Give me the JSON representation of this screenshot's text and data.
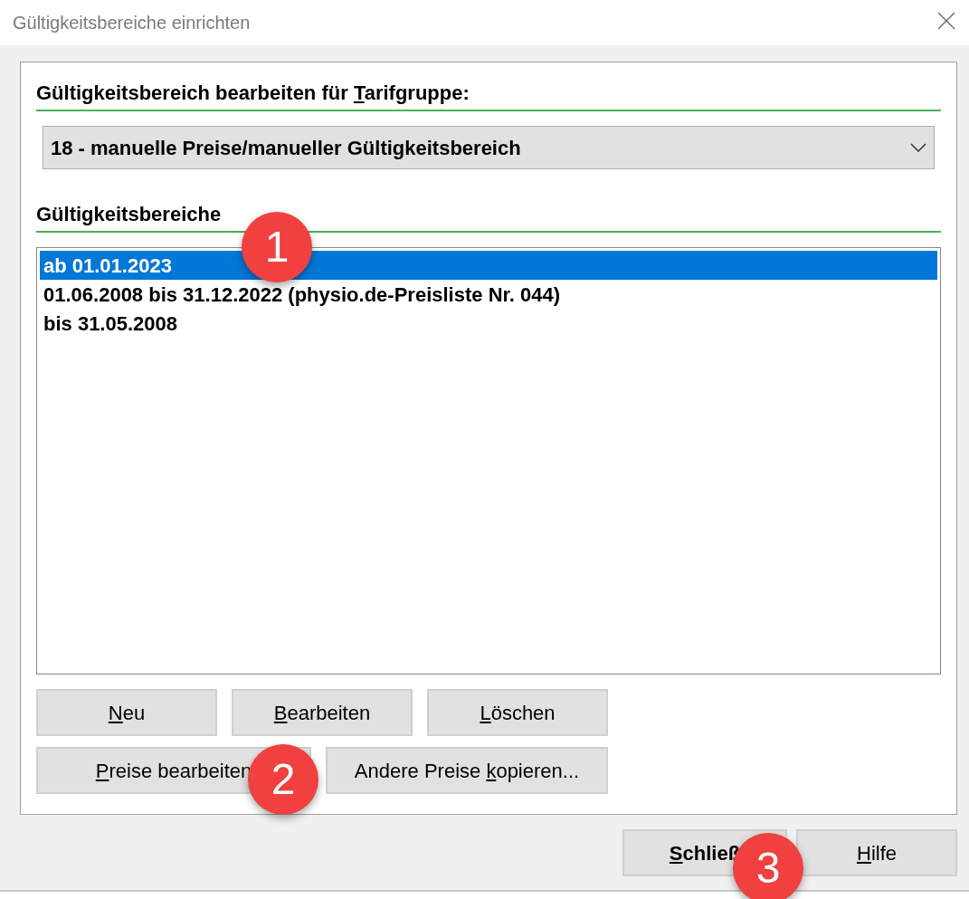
{
  "window": {
    "title": "Gültigkeitsbereiche einrichten"
  },
  "tarif_label": {
    "pre": "Gültigkeitsbereich bearbeiten für ",
    "key": "T",
    "post": "arifgruppe:"
  },
  "tarif_dropdown": {
    "value": "18 - manuelle Preise/manueller Gültigkeitsbereich"
  },
  "ranges_label": "Gültigkeitsbereiche",
  "ranges_list": [
    {
      "label": "ab 01.01.2023",
      "selected": true
    },
    {
      "label": "01.06.2008 bis 31.12.2022 (physio.de-Preisliste Nr. 044)",
      "selected": false
    },
    {
      "label": "bis 31.05.2008",
      "selected": false
    }
  ],
  "button_rows": [
    [
      {
        "key": "N",
        "post": "eu"
      },
      {
        "key": "B",
        "post": "earbeiten"
      },
      {
        "key": "L",
        "post": "öschen"
      }
    ],
    [
      {
        "key": "P",
        "post": "reise bearbeiten"
      },
      {
        "pre": "Andere Preise ",
        "key": "k",
        "post": "opieren..."
      }
    ]
  ],
  "footer_buttons": [
    {
      "key": "S",
      "post": "chließ",
      "bold": true
    },
    {
      "key": "H",
      "post": "ilfe",
      "bold": false
    }
  ],
  "callouts": [
    "1",
    "2",
    "3"
  ]
}
